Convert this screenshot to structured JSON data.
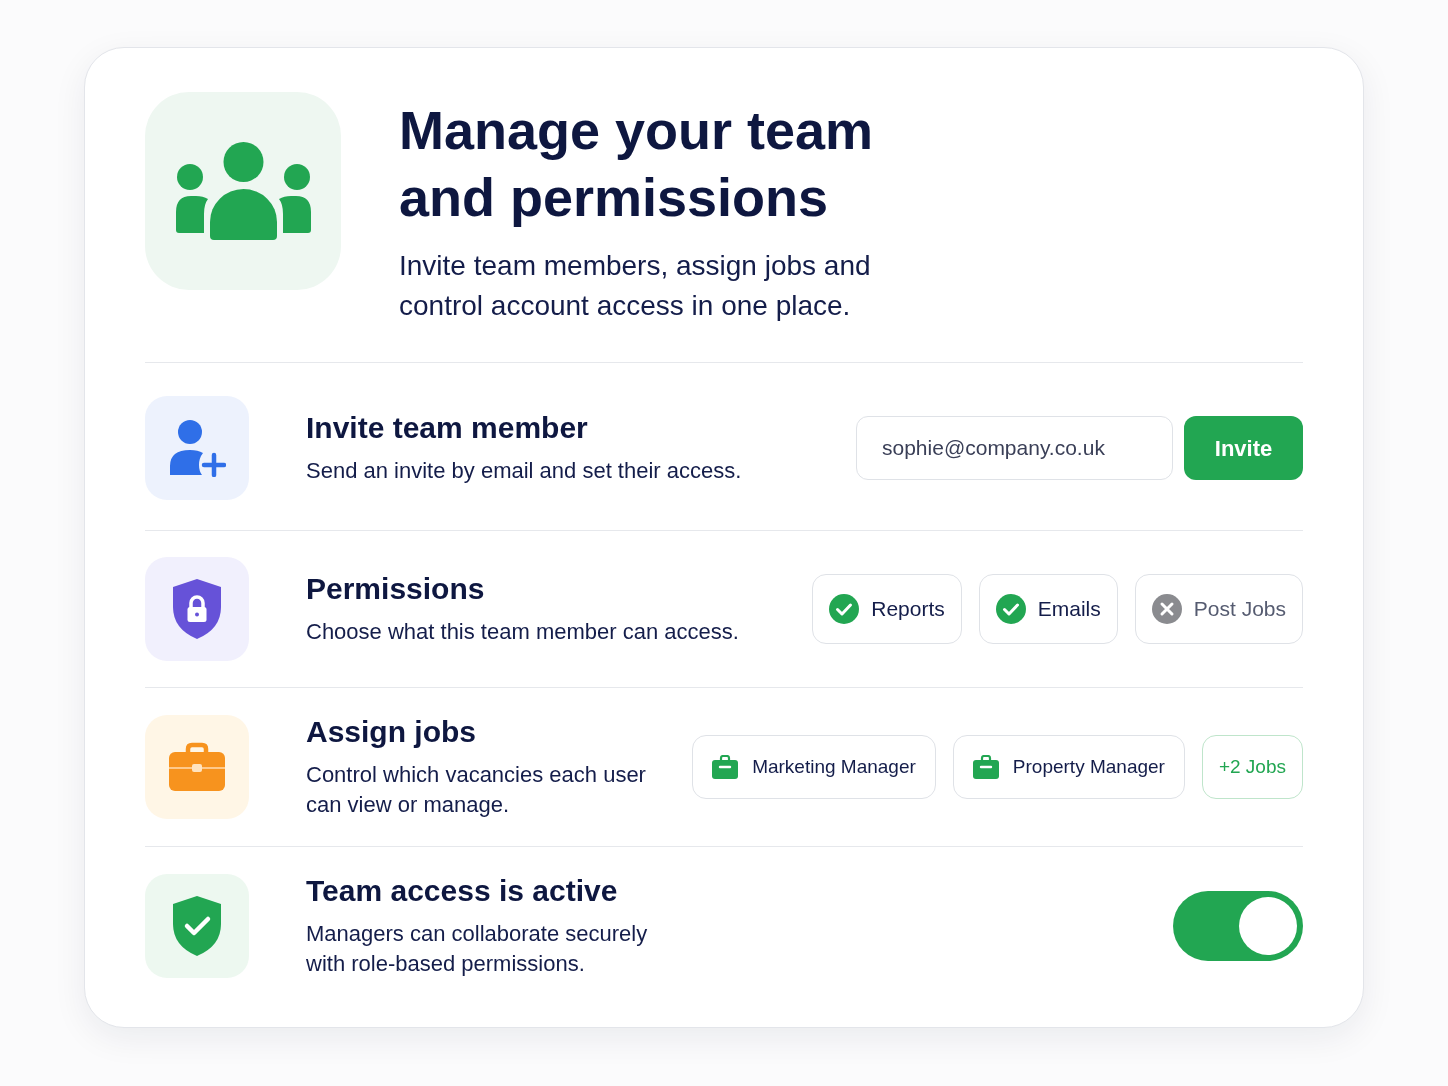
{
  "header": {
    "title": "Manage your team and permissions",
    "subtitle": "Invite team members, assign jobs and control account access in one place."
  },
  "sections": [
    {
      "kind": "invite",
      "title": "Invite team member",
      "description": "Send an invite by email and set their access.",
      "email_field": {
        "value": "sophie@company.co.uk"
      },
      "button": "Invite"
    },
    {
      "kind": "permissions",
      "title": "Permissions",
      "description": "Choose what this team member can access.",
      "permissions": [
        {
          "label": "Reports",
          "checked": true
        },
        {
          "label": "Emails",
          "checked": true
        },
        {
          "label": "Post Jobs",
          "checked": false
        }
      ]
    },
    {
      "kind": "jobs",
      "title": "Assign jobs",
      "description": "Control which vacancies each user can view or manage.",
      "jobs": [
        {
          "label": "Marketing Manager"
        },
        {
          "label": "Property Manager"
        }
      ],
      "more": "+2 Jobs"
    },
    {
      "kind": "status",
      "title": "Team access is active",
      "description": "Managers can collaborate securely with role-based permissions.",
      "toggle": {
        "on": true
      }
    }
  ]
}
